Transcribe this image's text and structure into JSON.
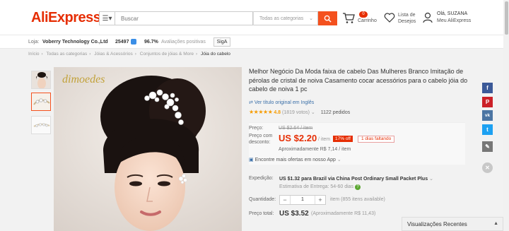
{
  "header": {
    "logo_text": "AliExpress",
    "search_placeholder": "Buscar",
    "search_category": "Todas as categorias",
    "cart_count": "0",
    "cart_label": "Carrinho",
    "wishlist_line1": "Lista de",
    "wishlist_line2": "Desejos",
    "user_greeting": "Olá, SUZANA",
    "user_account": "Meu AliExpress"
  },
  "store": {
    "label": "Loja:",
    "name": "Voberry Technology Co.,Ltd",
    "rating_count": "25497",
    "positive_pct": "96.7%",
    "positive_label": "Avaliações positivas",
    "follow_label": "SigA"
  },
  "breadcrumb": [
    "Início",
    "Todas as categorias",
    "Jóias & Acessórios",
    "Conjuntos de jóias & More",
    "Jóia do cabelo"
  ],
  "product": {
    "brand_watermark": "dimoedes",
    "title": "Melhor Negócio Da Moda faixa de cabelo Das Mulheres Branco Imitação de pérolas de cristal de noiva Casamento cocar acessórios para o cabelo jóia do cabelo de noiva 1 pc",
    "translate_link": "Ver título original em Inglês",
    "stars": "★★★★★",
    "rating": "4.8",
    "votes": "(1819 votos)",
    "orders": "1122 pedidos"
  },
  "price": {
    "label": "Preço:",
    "old": "US $2.64 / item",
    "discount_label": "Preço com desconto:",
    "current": "US $2.20",
    "unit": "/ item",
    "off_badge": "17% off",
    "days_left": "1 dias faltando",
    "approx": "Aproximadamente R$ 7,14 / item",
    "app_offer": "Encontre mais ofertas em nosso App"
  },
  "shipping": {
    "label": "Expedição:",
    "price": "US $1.32",
    "desc": "para Brazil via China Post Ordinary Small Packet Plus",
    "estimate": "Estimativa de Entrega: 54-60 dias"
  },
  "quantity": {
    "label": "Quantidade:",
    "minus": "−",
    "value": "1",
    "plus": "+",
    "available": "item (855 itens available)"
  },
  "total": {
    "label": "Preço total:",
    "value": "US $3.52",
    "approx": "(Aproximadamente R$ 11,43)"
  },
  "social": {
    "facebook": "f",
    "pinterest": "P",
    "vk": "vk",
    "twitter": "t",
    "edit": "✎",
    "close": "✕"
  },
  "recent": {
    "label": "Visualizações Recentes",
    "caret": "▲"
  },
  "colors": {
    "brand": "#e62e04",
    "accent": "#f4511e",
    "facebook": "#3b5998",
    "pinterest": "#cb2027",
    "vk": "#4c75a3",
    "twitter": "#1da1f2"
  }
}
